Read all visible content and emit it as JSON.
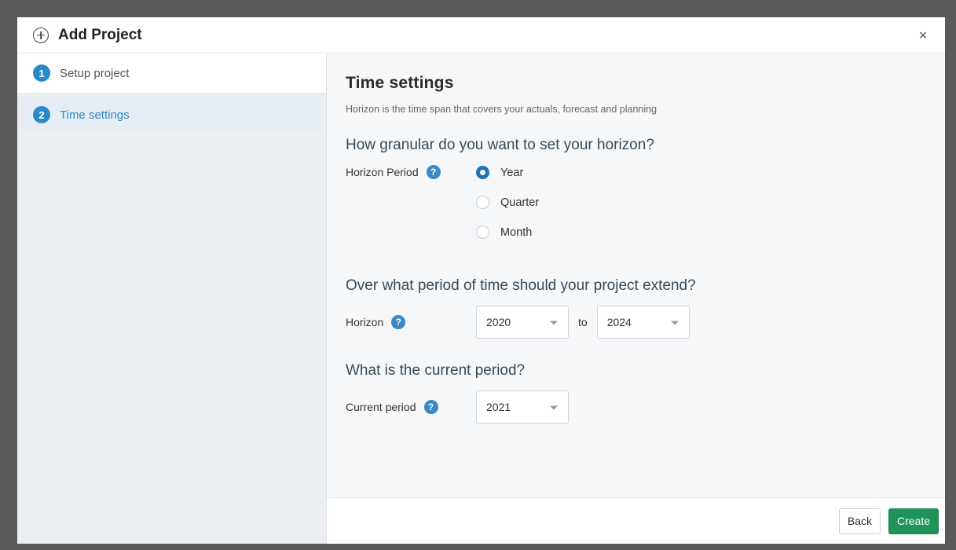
{
  "dialog": {
    "title": "Add Project",
    "close_label": "×"
  },
  "steps": [
    {
      "number": "1",
      "label": "Setup project",
      "active": false
    },
    {
      "number": "2",
      "label": "Time settings",
      "active": true
    }
  ],
  "main": {
    "title": "Time settings",
    "subtitle": "Horizon is the time span that covers your actuals, forecast and planning",
    "granularity": {
      "question": "How granular do you want to set your horizon?",
      "label": "Horizon Period",
      "options": [
        {
          "label": "Year",
          "checked": true
        },
        {
          "label": "Quarter",
          "checked": false
        },
        {
          "label": "Month",
          "checked": false
        }
      ]
    },
    "horizon": {
      "question": "Over what period of time should your project extend?",
      "label": "Horizon",
      "from": "2020",
      "to_text": "to",
      "to": "2024"
    },
    "current": {
      "question": "What is the current period?",
      "label": "Current period",
      "value": "2021"
    },
    "help_glyph": "?"
  },
  "footer": {
    "back_label": "Back",
    "create_label": "Create"
  },
  "colors": {
    "accent": "#2a8ac9",
    "create_button": "#1f9259",
    "radio_checked": "#1d73b6"
  },
  "icons": {
    "header": "plus-circle-icon",
    "close": "close-icon",
    "help": "help-icon",
    "dropdown": "chevron-down-icon"
  }
}
